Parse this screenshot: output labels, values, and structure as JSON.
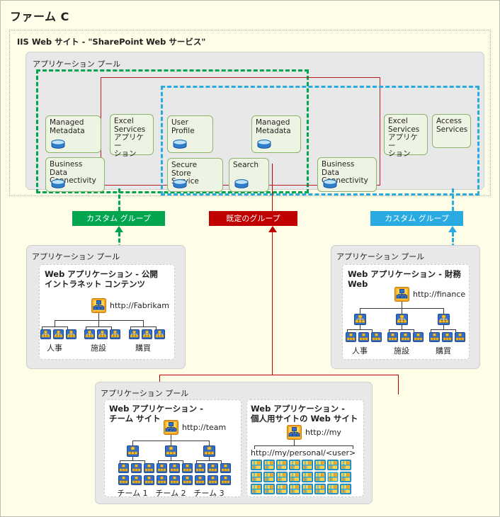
{
  "farm": {
    "title": "ファーム C"
  },
  "iis": {
    "title": "IIS Web サイト - \"SharePoint Web サービス\""
  },
  "app_pool_label": "アプリケーション プール",
  "services": {
    "pool_title": "アプリケーション プール",
    "items": [
      {
        "id": "svc-managed-metadata-1",
        "label": "Managed\nMetadata",
        "db": true
      },
      {
        "id": "svc-business-data-1",
        "label": "Business Data\nConnectivity",
        "db": true
      },
      {
        "id": "svc-excel-services-1",
        "label": "Excel\nServices\nアプリケー\nション",
        "db": false
      },
      {
        "id": "svc-user-profile",
        "label": "User\nProfile",
        "db": true
      },
      {
        "id": "svc-secure-store",
        "label": "Secure Store\nService",
        "db": true
      },
      {
        "id": "svc-search",
        "label": "Search",
        "db": true
      },
      {
        "id": "svc-managed-metadata-2",
        "label": "Managed\nMetadata",
        "db": true
      },
      {
        "id": "svc-business-data-2",
        "label": "Business Data\nConnectivity",
        "db": true
      },
      {
        "id": "svc-excel-services-2",
        "label": "Excel\nServices\nアプリケー\nション",
        "db": false
      },
      {
        "id": "svc-access-services",
        "label": "Access\nServices",
        "db": false
      }
    ]
  },
  "groups": {
    "custom_left": {
      "label": "カスタム グループ",
      "color": "#00a550"
    },
    "default_mid": {
      "label": "既定のグループ",
      "color": "#c00000"
    },
    "custom_right": {
      "label": "カスタム グループ",
      "color": "#29abe2"
    }
  },
  "webapps": {
    "public": {
      "pool": "アプリケーション プール",
      "title": "Web アプリケーション - 公開\nイントラネット コンテンツ",
      "url": "http://Fabrikam",
      "children": [
        "人事",
        "施設",
        "購買"
      ]
    },
    "finance": {
      "pool": "アプリケーション プール",
      "title": "Web アプリケーション - 財務 Web",
      "url": "http://finance",
      "children": [
        "人事",
        "施設",
        "購買"
      ]
    },
    "team": {
      "pool": "アプリケーション プール",
      "title": "Web アプリケーション -\nチーム サイト",
      "url": "http://team",
      "children": [
        "チーム 1",
        "チーム 2",
        "チーム 3"
      ]
    },
    "mysite": {
      "title": "Web アプリケーション -\n個人用サイトの Web サイト",
      "url": "http://my",
      "personal_url": "http://my/personal/<user>"
    }
  },
  "icons": {
    "database": "database-icon",
    "site_root": "site-collection-icon",
    "site_child": "sub-site-icon",
    "personal_site": "personal-site-icon"
  }
}
